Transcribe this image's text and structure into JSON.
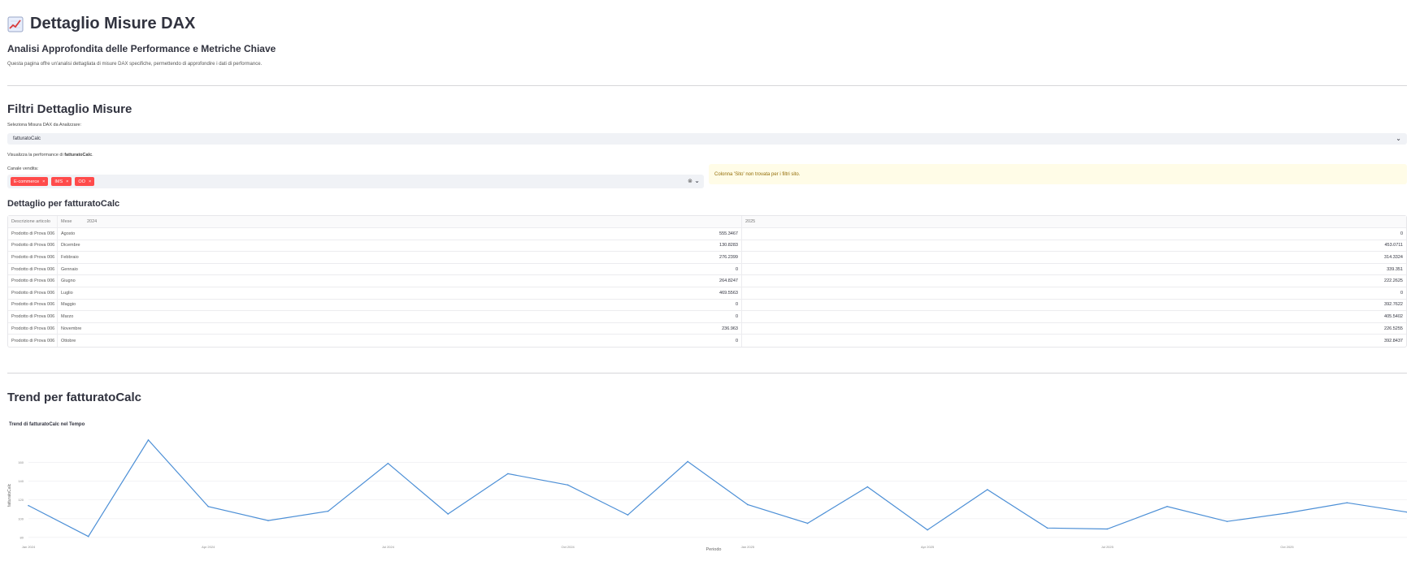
{
  "header": {
    "title": "Dettaglio Misure DAX",
    "subtitle": "Analisi Approfondita delle Performance e Metriche Chiave",
    "description": "Questa pagina offre un'analisi dettagliata di misure DAX specifiche, permettendo di approfondire i dati di performance.",
    "icon": "chart-increasing-icon"
  },
  "filters": {
    "title": "Filtri Dettaglio Misure",
    "measure_label": "Seleziona Misura DAX da Analizzare:",
    "measure_value": "fatturatoCalc",
    "perf_prefix": "Visualizza la performance di ",
    "perf_measure": "fatturatoCalc",
    "perf_suffix": ".",
    "channel_label": "Canale vendita:",
    "channels": [
      "E-commerce",
      "IMS",
      "OO"
    ],
    "warning": "Colonna 'Sito' non trovata per i filtri sito."
  },
  "detail": {
    "title": "Dettaglio per fatturatoCalc",
    "columns": [
      "Descrizione articolo",
      "Mese",
      "2024",
      "2025"
    ],
    "rows": [
      [
        "Prodotto di Prova 006",
        "Agosto",
        "555.3467",
        "0"
      ],
      [
        "Prodotto di Prova 006",
        "Dicembre",
        "130.8283",
        "453.0711"
      ],
      [
        "Prodotto di Prova 006",
        "Febbraio",
        "276.2399",
        "314.3324"
      ],
      [
        "Prodotto di Prova 006",
        "Gennaio",
        "0",
        "339.351"
      ],
      [
        "Prodotto di Prova 006",
        "Giugno",
        "264.8247",
        "222.2625"
      ],
      [
        "Prodotto di Prova 006",
        "Luglio",
        "469.5563",
        "0"
      ],
      [
        "Prodotto di Prova 006",
        "Maggio",
        "0",
        "392.7622"
      ],
      [
        "Prodotto di Prova 006",
        "Marzo",
        "0",
        "405.5402"
      ],
      [
        "Prodotto di Prova 006",
        "Novembre",
        "236.963",
        "226.5255"
      ],
      [
        "Prodotto di Prova 006",
        "Ottobre",
        "0",
        "392.8437"
      ]
    ]
  },
  "trend": {
    "title": "Trend per fatturatoCalc"
  },
  "chart_data": {
    "type": "line",
    "title": "Trend di fatturatoCalc nel Tempo",
    "xlabel": "Periodo",
    "ylabel": "fatturatoCalc",
    "x": [
      "2024-01",
      "2024-02",
      "2024-03",
      "2024-04",
      "2024-05",
      "2024-06",
      "2024-07",
      "2024-08",
      "2024-09",
      "2024-10",
      "2024-11",
      "2024-12",
      "2025-01",
      "2025-02",
      "2025-03",
      "2025-04",
      "2025-05",
      "2025-06",
      "2025-07",
      "2025-08",
      "2025-09",
      "2025-10",
      "2025-11",
      "2025-12"
    ],
    "x_tick_labels": [
      "Jan 2024",
      "Apr 2024",
      "Jul 2024",
      "Oct 2024",
      "Jan 2025",
      "Apr 2025",
      "Jul 2025",
      "Oct 2025"
    ],
    "y_tick_labels": [
      "80",
      "100",
      "120",
      "140",
      "160"
    ],
    "values": [
      114,
      81,
      184,
      113,
      98,
      108,
      159,
      105,
      148,
      136,
      104,
      161,
      115,
      95,
      134,
      88,
      131,
      90,
      89,
      113,
      97,
      106,
      117,
      107
    ],
    "ylim": [
      79,
      190
    ],
    "line_color": "#4c8fd6",
    "grid": true
  }
}
